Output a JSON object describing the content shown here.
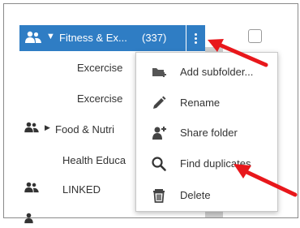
{
  "folder_header": {
    "name": "Fitness & Ex...",
    "count": "(337)",
    "user_icon": "shared-users-icon",
    "caret_icon": "caret-down-icon",
    "menu_icon": "kebab-menu-icon"
  },
  "folder_list": [
    {
      "label": "Excercise",
      "icon": ""
    },
    {
      "label": "Excercise",
      "icon": ""
    },
    {
      "label": "Food & Nutri",
      "icon": "shared-users-icon"
    },
    {
      "label": "Health Educa",
      "icon": ""
    },
    {
      "label": "LINKED",
      "icon": "shared-users-icon"
    }
  ],
  "context_menu": [
    {
      "label": "Add subfolder...",
      "icon": "add-folder-icon"
    },
    {
      "label": "Rename",
      "icon": "pencil-icon"
    },
    {
      "label": "Share folder",
      "icon": "add-user-icon"
    },
    {
      "label": "Find duplicates",
      "icon": "search-icon"
    },
    {
      "label": "Delete",
      "icon": "trash-icon"
    }
  ],
  "colors": {
    "header_blue": "#2f7dc4",
    "annotation_red": "#e8171b"
  }
}
